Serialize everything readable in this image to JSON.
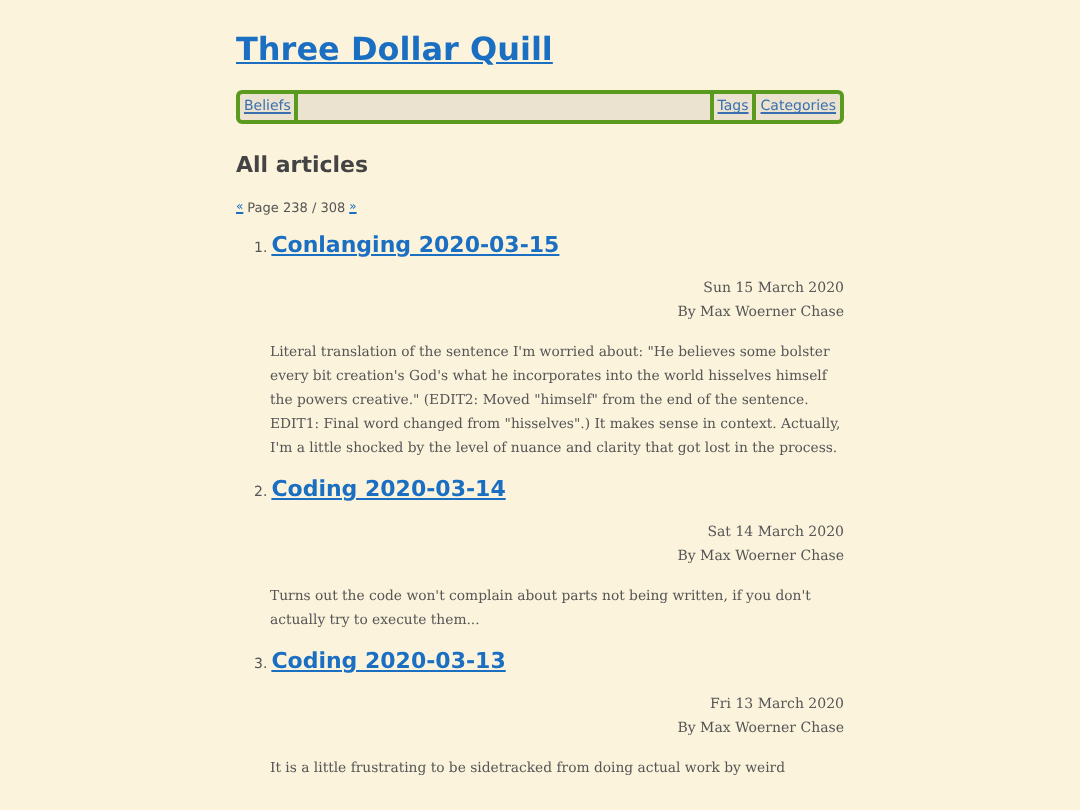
{
  "site_title": "Three Dollar Quill",
  "nav": {
    "left": [
      "Beliefs"
    ],
    "right": [
      "Tags",
      "Categories"
    ]
  },
  "heading": "All articles",
  "pager": {
    "prev": "«",
    "text": "Page 238 / 308",
    "next": "»"
  },
  "articles": [
    {
      "number": "1.",
      "title": "Conlanging 2020-03-15",
      "date": "Sun 15 March 2020",
      "author": "By Max Woerner Chase",
      "summary": "Literal translation of the sentence I'm worried about: \"He believes some bolster every bit creation's God's what he incorporates into the world hisselves himself the powers creative.\" (EDIT2: Moved \"himself\" from the end of the sentence. EDIT1: Final word changed from \"hisselves\".) It makes sense in context. Actually, I'm a little shocked by the level of nuance and clarity that got lost in the process."
    },
    {
      "number": "2.",
      "title": "Coding 2020-03-14",
      "date": "Sat 14 March 2020",
      "author": "By Max Woerner Chase",
      "summary": "Turns out the code won't complain about parts not being written, if you don't actually try to execute them..."
    },
    {
      "number": "3.",
      "title": "Coding 2020-03-13",
      "date": "Fri 13 March 2020",
      "author": "By Max Woerner Chase",
      "summary": "It is a little frustrating to be sidetracked from doing actual work by weird"
    }
  ]
}
